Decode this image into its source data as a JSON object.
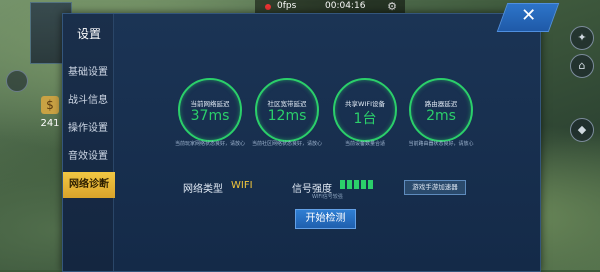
{
  "hud": {
    "gold": "241",
    "fps": "0fps",
    "timer": "00:04:16",
    "gear_icon": "gear-icon"
  },
  "settings": {
    "title": "设置",
    "menu": [
      {
        "label": "基础设置"
      },
      {
        "label": "战斗信息"
      },
      {
        "label": "操作设置"
      },
      {
        "label": "音效设置"
      },
      {
        "label": "网络诊断"
      }
    ],
    "metrics": [
      {
        "label": "当前网络延迟",
        "value": "37ms",
        "desc": "当前玩家网络状态良好，请放心"
      },
      {
        "label": "社区宽带延迟",
        "value": "12ms",
        "desc": "当前社区网络状态良好，请放心"
      },
      {
        "label": "共享WIFI设备",
        "value": "1台",
        "desc": "当前设备数量合适"
      },
      {
        "label": "路由器延迟",
        "value": "2ms",
        "desc": "当前路由器状态良好，请放心"
      }
    ],
    "net_type_label": "网络类型",
    "net_type_value": "WIFI",
    "signal_label": "信号强度",
    "signal_strength": 1.0,
    "signal_note": "WIFI信号较强",
    "accel_button": "游戏手游加速器",
    "start_button": "开始检测"
  },
  "colors": {
    "accent_green": "#2bcf6a",
    "active_tab": "#f1c743",
    "panel_bg": "#1b3455",
    "button_blue": "#2f7fd3"
  }
}
